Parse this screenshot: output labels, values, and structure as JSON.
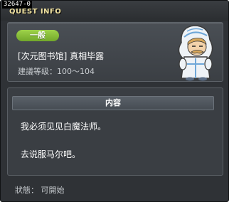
{
  "window": {
    "id": "32647-0",
    "title": "QUEST INFO"
  },
  "quest": {
    "category": "一般",
    "name": "[次元图书馆] 真相毕露",
    "level_label": "建議等级：",
    "level_range": "100～104"
  },
  "content": {
    "header": "内容",
    "lines": [
      "我必须见见白魔法师。",
      "去说服马尔吧。"
    ]
  },
  "status": {
    "label": "狀態：",
    "value": "可開始"
  },
  "npc": {
    "icon": "white-hooded-mage-npc"
  },
  "colors": {
    "title": "#f2e4a2",
    "badge": "#8cc63f",
    "window_bg": "#2f3236"
  }
}
